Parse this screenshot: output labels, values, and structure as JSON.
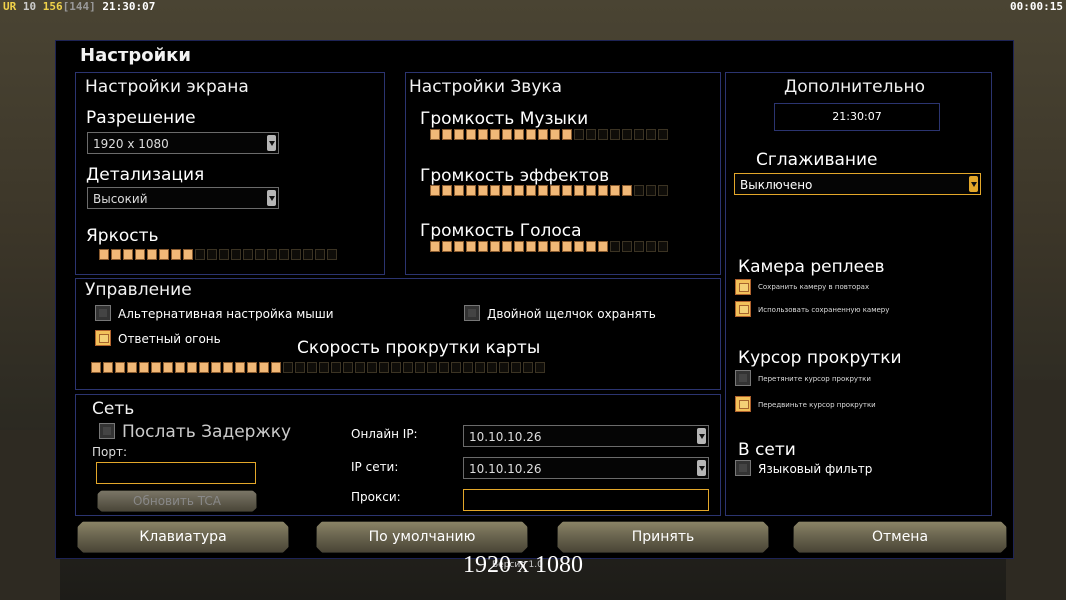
{
  "hud": {
    "player": "UR",
    "stat1": "10",
    "stat2": "156",
    "stat3": "[144]",
    "clock": "21:30:07",
    "timer": "00:00:15"
  },
  "title": "Настройки",
  "screen": {
    "header": "Настройки экрана",
    "resolution_label": "Разрешение",
    "resolution_value": "1920 x 1080",
    "detail_label": "Детализация",
    "detail_value": "Высокий",
    "brightness_label": "Яркость",
    "brightness_level": 8,
    "brightness_total": 20
  },
  "sound": {
    "header": "Настройки Звука",
    "music_label": "Громкость Музыки",
    "music_level": 12,
    "music_total": 20,
    "effects_label": "Громкость эффектов",
    "effects_level": 17,
    "effects_total": 20,
    "voice_label": "Громкость Голоса",
    "voice_level": 15,
    "voice_total": 20
  },
  "extra": {
    "header": "Дополнительно",
    "time": "21:30:07",
    "aa_label": "Сглаживание",
    "aa_value": "Выключено",
    "replay_header": "Камера реплеев",
    "replay_opt1": "Сохранить камеру в повторах",
    "replay_opt2": "Использовать сохраненную камеру",
    "cursor_header": "Курсор прокрутки",
    "cursor_opt1": "Перетяните курсор прокрутки",
    "cursor_opt2": "Передвиньте курсор прокрутки",
    "online_header": "В сети",
    "lang_filter": "Языковый фильтр"
  },
  "control": {
    "header": "Управление",
    "alt_mouse": "Альтернативная настройка мыши",
    "double_click": "Двойной щелчок охранять",
    "return_fire": "Ответный огонь",
    "scroll_label": "Скорость прокрутки карты",
    "scroll_level": 16,
    "scroll_total": 38
  },
  "network": {
    "header": "Сеть",
    "send_delay": "Послать Задержку",
    "port_label": "Порт:",
    "port_value": "",
    "update_tca": "Обновить TCA",
    "online_ip_label": "Онлайн IP:",
    "online_ip_value": "10.10.10.26",
    "lan_ip_label": "IP сети:",
    "lan_ip_value": "10.10.10.26",
    "proxy_label": "Прокси:",
    "proxy_value": ""
  },
  "buttons": {
    "keyboard": "Клавиатура",
    "defaults": "По умолчанию",
    "accept": "Принять",
    "cancel": "Отмена"
  },
  "bottom": {
    "resolution_text": "1920 x 1080",
    "version_text": "Версия 1.0"
  },
  "colors": {
    "slider_on": "#f1b877",
    "accent": "#e3a72a",
    "panel_border": "#2b3470"
  }
}
